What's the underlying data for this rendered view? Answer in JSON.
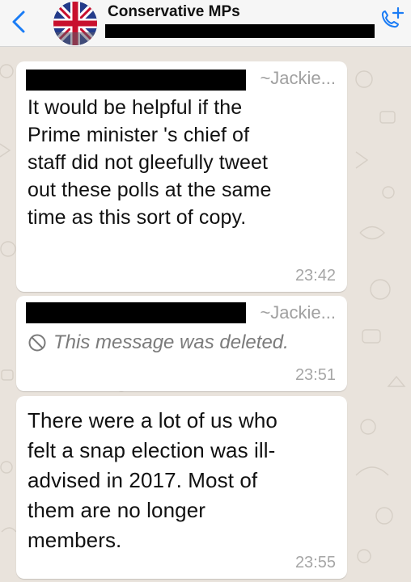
{
  "header": {
    "back_icon": "chevron-left-icon",
    "title": "Conservative MPs",
    "call_icon": "add-call-icon",
    "accent_color": "#1a7cf5"
  },
  "messages": [
    {
      "sender": "~Jackie...",
      "text_lines": [
        "It would be helpful if the",
        "Prime minister 's chief of",
        "staff did not gleefully tweet",
        "out these polls at the same",
        "time as this sort of copy."
      ],
      "time": "23:42"
    },
    {
      "sender": "~Jackie...",
      "deleted_text": "This message was deleted.",
      "deleted_icon": "block-icon",
      "time": "23:51"
    },
    {
      "text_lines": [
        "There were a lot of us who",
        "felt a snap election was ill-",
        "advised in 2017. Most of",
        "them are no longer",
        "members."
      ],
      "time": "23:55"
    }
  ]
}
